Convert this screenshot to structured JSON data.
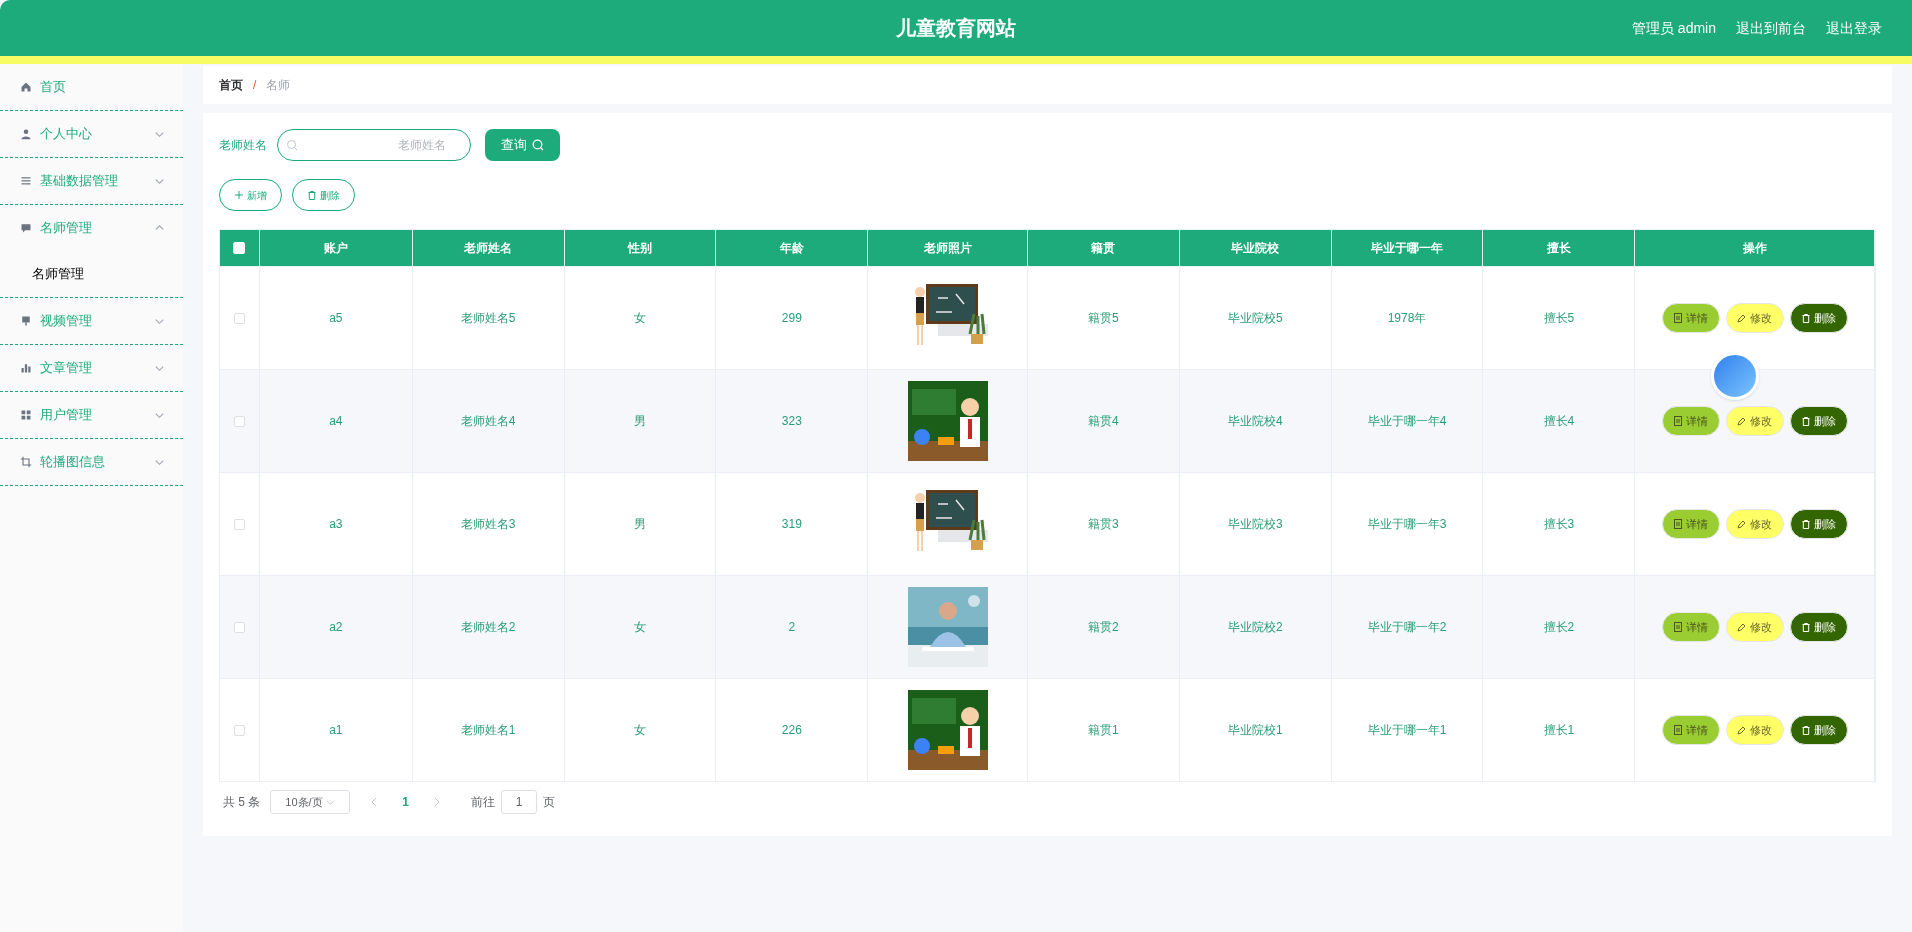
{
  "header": {
    "title": "儿童教育网站",
    "links": [
      "管理员 admin",
      "退出到前台",
      "退出登录"
    ]
  },
  "sidebar": {
    "items": [
      {
        "label": "首页"
      },
      {
        "label": "个人中心",
        "expanded": false
      },
      {
        "label": "基础数据管理",
        "expanded": false
      },
      {
        "label": "名师管理",
        "expanded": true,
        "children": [
          {
            "label": "名师管理",
            "selected": true
          }
        ]
      },
      {
        "label": "视频管理",
        "expanded": false
      },
      {
        "label": "文章管理",
        "expanded": false
      },
      {
        "label": "用户管理",
        "expanded": false
      },
      {
        "label": "轮播图信息",
        "expanded": false
      }
    ]
  },
  "breadcrumb": {
    "items": [
      "首页",
      "名师"
    ],
    "separator": "/"
  },
  "search": {
    "label": "老师姓名",
    "placeholder": "老师姓名",
    "button": "查询"
  },
  "actions": [
    "新增",
    "删除"
  ],
  "table": {
    "select_all_checked": false,
    "columns": [
      "账户",
      "老师姓名",
      "性别",
      "年龄",
      "老师照片",
      "籍贯",
      "毕业院校",
      "毕业于哪一年",
      "擅长",
      "操作"
    ],
    "rows": [
      {
        "checked": false,
        "cells": [
          "a5",
          "老师姓名5",
          "女",
          "299",
          {
            "kind": "picture"
          },
          "籍贯5",
          "毕业院校5",
          "1978年",
          "擅长5"
        ],
        "buttons": [
          "详情",
          "修改",
          "删除"
        ]
      },
      {
        "checked": false,
        "cells": [
          "a4",
          "老师姓名4",
          "男",
          "323",
          {
            "kind": "picture"
          },
          "籍贯4",
          "毕业院校4",
          "毕业于哪一年4",
          "擅长4"
        ],
        "buttons": [
          "详情",
          "修改",
          "删除"
        ]
      },
      {
        "checked": false,
        "cells": [
          "a3",
          "老师姓名3",
          "男",
          "319",
          {
            "kind": "picture"
          },
          "籍贯3",
          "毕业院校3",
          "毕业于哪一年3",
          "擅长3"
        ],
        "buttons": [
          "详情",
          "修改",
          "删除"
        ]
      },
      {
        "checked": false,
        "cells": [
          "a2",
          "老师姓名2",
          "女",
          "2",
          {
            "kind": "picture"
          },
          "籍贯2",
          "毕业院校2",
          "毕业于哪一年2",
          "擅长2"
        ],
        "buttons": [
          "详情",
          "修改",
          "删除"
        ]
      },
      {
        "checked": false,
        "cells": [
          "a1",
          "老师姓名1",
          "女",
          "226",
          {
            "kind": "picture"
          },
          "籍贯1",
          "毕业院校1",
          "毕业于哪一年1",
          "擅长1"
        ],
        "buttons": [
          "详情",
          "修改",
          "删除"
        ]
      }
    ]
  },
  "pagination": {
    "total": "共 5 条",
    "page_size": "10条/页",
    "current": "1",
    "goto_label": "前往",
    "goto_value": "1",
    "page_label": "页"
  }
}
